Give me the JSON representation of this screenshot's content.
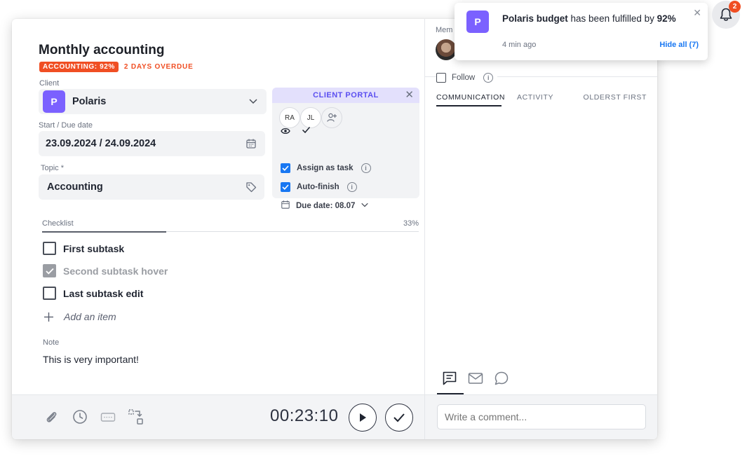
{
  "task": {
    "title": "Monthly accounting",
    "status_badge": "ACCOUNTING: 92%",
    "overdue_badge": "2 DAYS OVERDUE"
  },
  "client": {
    "label": "Client",
    "initial": "P",
    "name": "Polaris"
  },
  "dates": {
    "label": "Start / Due date",
    "value": "23.09.2024 / 24.09.2024"
  },
  "topic": {
    "label": "Topic *",
    "value": "Accounting"
  },
  "portal": {
    "title": "CLIENT PORTAL",
    "avatars": [
      "RA",
      "JL"
    ],
    "assign_label": "Assign as task",
    "autofinish_label": "Auto-finish",
    "due_label": "Due date: 08.07"
  },
  "checklist": {
    "label": "Checklist",
    "percent": "33%",
    "progress": 0.33,
    "items": [
      {
        "label": "First subtask",
        "done": false
      },
      {
        "label": "Second subtask hover",
        "done": true
      },
      {
        "label": "Last subtask edit",
        "done": false
      }
    ],
    "add_label": "Add an item"
  },
  "note": {
    "label": "Note",
    "text": "This is very important!"
  },
  "footer": {
    "timer": "00:23:10"
  },
  "right": {
    "members_label": "Mem",
    "follow_label": "Follow",
    "tabs": [
      "COMMUNICATION",
      "ACTIVITY"
    ],
    "sort_label": "OLDERST FIRST",
    "comment_placeholder": "Write a comment..."
  },
  "notification": {
    "initial": "P",
    "subject": "Polaris budget",
    "message_mid": "has been fulfilled by",
    "value": "92%",
    "time": "4 min ago",
    "hide_all": "Hide all (7)",
    "bell_count": "2"
  },
  "colors": {
    "accent": "#7b61ff",
    "danger": "#f04e23",
    "link": "#1877f2"
  }
}
